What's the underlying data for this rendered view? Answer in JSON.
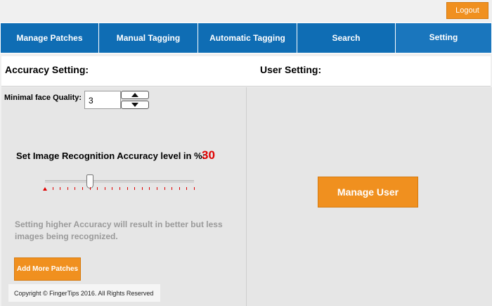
{
  "logout_label": "Logout",
  "tabs": [
    {
      "label": "Manage Patches"
    },
    {
      "label": "Manual Tagging"
    },
    {
      "label": "Automatic Tagging"
    },
    {
      "label": "Search"
    },
    {
      "label": "Setting"
    }
  ],
  "active_tab": "Setting",
  "accuracy_setting": {
    "heading": "Accuracy Setting:",
    "min_face_quality_label": "Minimal face Quality:",
    "min_face_quality_value": "3",
    "accuracy_label": "Set Image Recognition Accuracy level in %:",
    "accuracy_value": "30",
    "slider": {
      "min": 0,
      "max": 100,
      "value": 30
    },
    "note": "Setting higher Accuracy will result in better but less images being recognized.",
    "add_patches_label": "Add More Patches"
  },
  "user_setting": {
    "heading": "User Setting:",
    "manage_user_label": "Manage User"
  },
  "footer": "Copyright © FingerTips 2016. All Rights Reserved",
  "colors": {
    "tab_blue": "#0f6db4",
    "orange": "#f0901f",
    "accuracy_red": "#e00000"
  }
}
